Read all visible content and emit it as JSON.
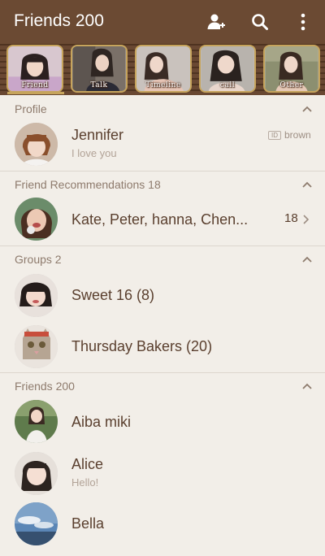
{
  "header": {
    "title": "Friends 200"
  },
  "tabs": [
    {
      "label": "Friend"
    },
    {
      "label": "Talk"
    },
    {
      "label": "Timeline"
    },
    {
      "label": "call"
    },
    {
      "label": "Other"
    }
  ],
  "profile": {
    "section_title": "Profile",
    "name": "Jennifer",
    "status": "I love you",
    "id_label": "ID",
    "id_value": "brown"
  },
  "recommendations": {
    "section_title": "Friend Recommendations 18",
    "names": "Kate, Peter, hanna, Chen...",
    "count": "18"
  },
  "groups": {
    "section_title": "Groups 2",
    "items": [
      {
        "name": "Sweet 16 (8)"
      },
      {
        "name": "Thursday Bakers (20)"
      }
    ]
  },
  "friends": {
    "section_title": "Friends 200",
    "items": [
      {
        "name": "Aiba miki",
        "status": ""
      },
      {
        "name": "Alice",
        "status": "Hello!"
      },
      {
        "name": "Bella",
        "status": ""
      }
    ]
  },
  "colors": {
    "header_bg": "#6b4a33",
    "page_bg": "#f2eee8",
    "tab_border": "#c6a45c",
    "text_primary": "#5a3f2e",
    "text_secondary": "#b2a397"
  }
}
